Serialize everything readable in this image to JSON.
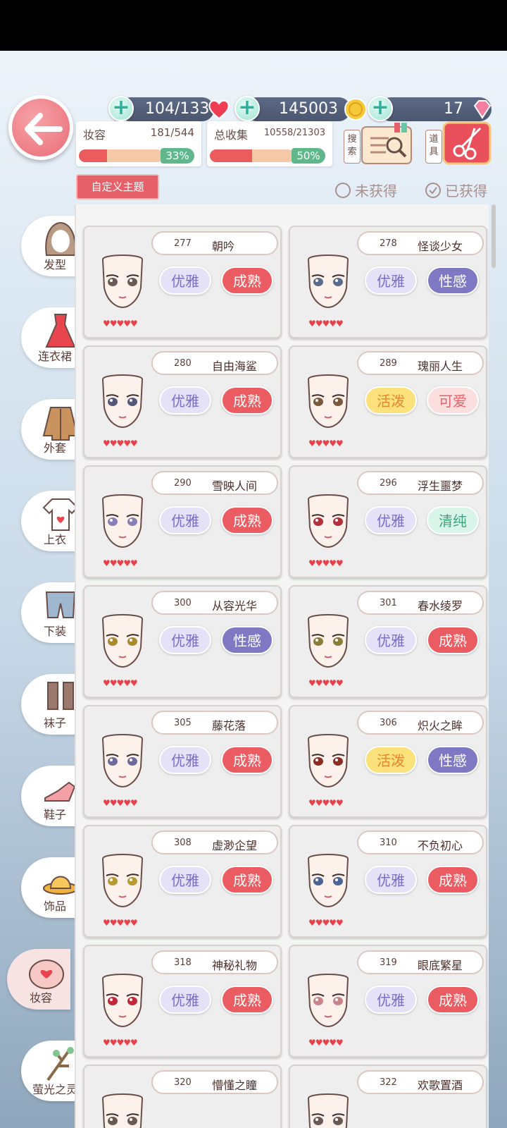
{
  "header": {
    "stamina": "104/133",
    "coins": "145003",
    "diamonds": "17",
    "makeup_label": "妆容",
    "makeup_count": "181/544",
    "makeup_pct_text": "33%",
    "makeup_progress": 0.33,
    "collection_label": "总收集",
    "collection_count": "10558/21303",
    "collection_pct_text": "50%",
    "collection_progress": 0.5,
    "search_label": "搜索",
    "tools_label": "道具",
    "custom_theme": "自定义主题",
    "filter_unobtained": "未获得",
    "filter_obtained": "已获得"
  },
  "sidebar": [
    {
      "label": "发型",
      "icon": "hair-icon"
    },
    {
      "label": "连衣裙",
      "icon": "dress-icon"
    },
    {
      "label": "外套",
      "icon": "coat-icon"
    },
    {
      "label": "上衣",
      "icon": "shirt-icon"
    },
    {
      "label": "下装",
      "icon": "pants-icon"
    },
    {
      "label": "袜子",
      "icon": "socks-icon"
    },
    {
      "label": "鞋子",
      "icon": "shoes-icon"
    },
    {
      "label": "饰品",
      "icon": "hat-icon"
    },
    {
      "label": "妆容",
      "icon": "compact-icon",
      "active": true
    },
    {
      "label": "萤光之灵",
      "icon": "branch-icon"
    }
  ],
  "items": [
    {
      "id": "277",
      "name": "朝吟",
      "tags": [
        "优雅",
        "成熟"
      ],
      "eye": "#6b5a52"
    },
    {
      "id": "278",
      "name": "怪谈少女",
      "tags": [
        "优雅",
        "性感"
      ],
      "eye": "#5a6b8c"
    },
    {
      "id": "280",
      "name": "自由海鲨",
      "tags": [
        "优雅",
        "成熟"
      ],
      "eye": "#55577a"
    },
    {
      "id": "289",
      "name": "瑰丽人生",
      "tags": [
        "活泼",
        "可爱"
      ],
      "eye": "#7a5a3c"
    },
    {
      "id": "290",
      "name": "雪映人间",
      "tags": [
        "优雅",
        "成熟"
      ],
      "eye": "#8b7fb8"
    },
    {
      "id": "296",
      "name": "浮生噩梦",
      "tags": [
        "优雅",
        "清纯"
      ],
      "eye": "#b3313b"
    },
    {
      "id": "300",
      "name": "从容光华",
      "tags": [
        "优雅",
        "性感"
      ],
      "eye": "#a88a2c"
    },
    {
      "id": "301",
      "name": "春水绫罗",
      "tags": [
        "优雅",
        "成熟"
      ],
      "eye": "#8a7d3a"
    },
    {
      "id": "305",
      "name": "藤花落",
      "tags": [
        "优雅",
        "成熟"
      ],
      "eye": "#6f6a9c"
    },
    {
      "id": "306",
      "name": "炽火之眸",
      "tags": [
        "活泼",
        "性感"
      ],
      "eye": "#8b2f25"
    },
    {
      "id": "308",
      "name": "虚渺企望",
      "tags": [
        "优雅",
        "成熟"
      ],
      "eye": "#b59b32"
    },
    {
      "id": "310",
      "name": "不负初心",
      "tags": [
        "优雅",
        "成熟"
      ],
      "eye": "#4d6592"
    },
    {
      "id": "318",
      "name": "神秘礼物",
      "tags": [
        "优雅",
        "成熟"
      ],
      "eye": "#c0283a"
    },
    {
      "id": "319",
      "name": "眼底繁星",
      "tags": [
        "优雅",
        "成熟"
      ],
      "eye": "#c9848b"
    },
    {
      "id": "320",
      "name": "懵懂之瞳",
      "tags": [],
      "eye": "#6b5a52"
    },
    {
      "id": "322",
      "name": "欢歌置酒",
      "tags": [],
      "eye": "#6b5a52"
    }
  ],
  "rating": "♥♥♥♥♥"
}
